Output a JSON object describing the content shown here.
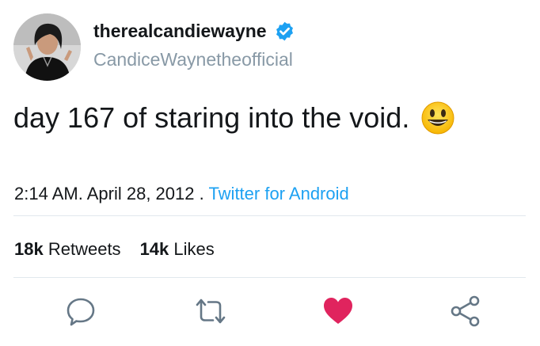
{
  "user": {
    "name": "therealcandiewayne",
    "handle": "CandiceWaynetheofficial",
    "verified": true,
    "avatar": "profile-photo"
  },
  "tweet": {
    "text": "day 167 of staring into the void.",
    "emoji": "grinning-face-emoji"
  },
  "meta": {
    "time": "2:14 AM. April 28, 2012 . ",
    "source": "Twitter for Android"
  },
  "stats": {
    "retweets_count": "18k",
    "retweets_label": "Retweets",
    "likes_count": "14k",
    "likes_label": "Likes"
  },
  "actions": {
    "reply_icon": "reply-icon",
    "retweet_icon": "retweet-icon",
    "like_icon": "heart-icon",
    "share_icon": "share-icon"
  },
  "colors": {
    "text": "#14171a",
    "muted": "#8899a6",
    "link": "#1da1f2",
    "verified": "#1da1f2",
    "like": "#e0245e",
    "icon": "#657786",
    "divider": "#e1e8ed"
  }
}
